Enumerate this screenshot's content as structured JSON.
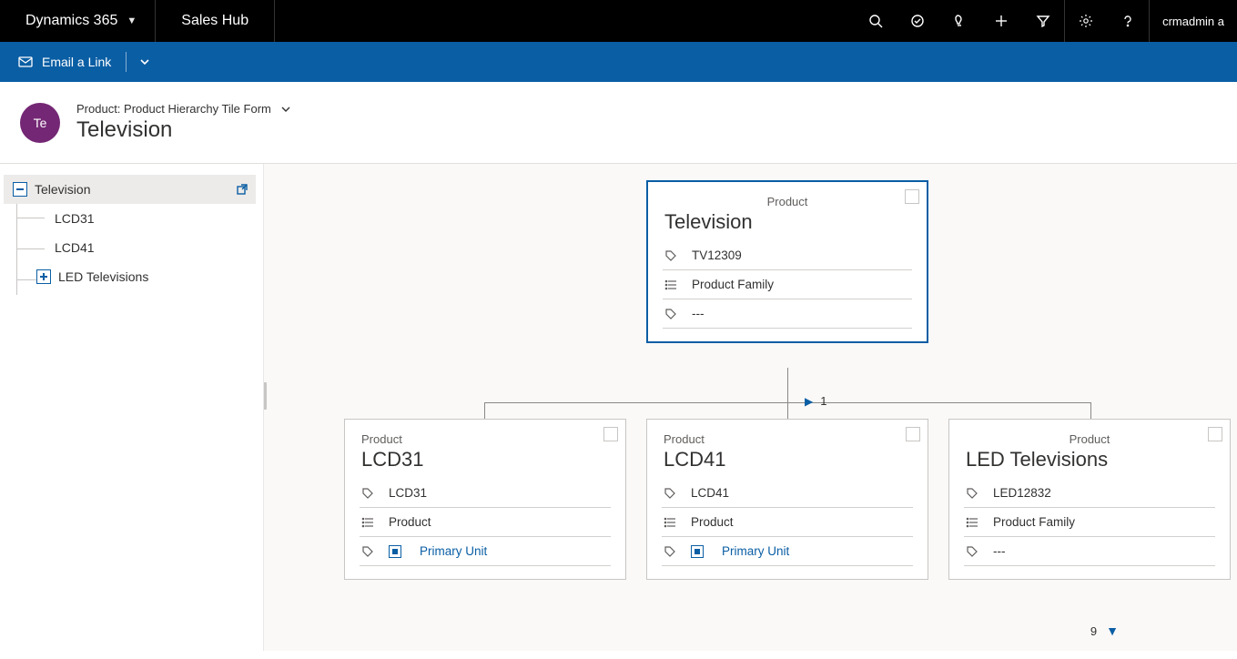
{
  "topbar": {
    "brand": "Dynamics 365",
    "app": "Sales Hub",
    "user": "crmadmin a"
  },
  "cmdbar": {
    "email_link": "Email a Link"
  },
  "header": {
    "avatar": "Te",
    "crumb": "Product: Product Hierarchy Tile Form",
    "title": "Television"
  },
  "tree": {
    "items": [
      {
        "label": "Television"
      },
      {
        "label": "LCD31"
      },
      {
        "label": "LCD41"
      },
      {
        "label": "LED Televisions"
      }
    ]
  },
  "paging": {
    "top": "1",
    "bottom": "9"
  },
  "tiles": {
    "root": {
      "kind": "Product",
      "name": "Television",
      "code": "TV12309",
      "type": "Product Family",
      "unit": "---"
    },
    "children": [
      {
        "kind": "Product",
        "name": "LCD31",
        "code": "LCD31",
        "type": "Product",
        "unit": "Primary Unit",
        "unit_link": true
      },
      {
        "kind": "Product",
        "name": "LCD41",
        "code": "LCD41",
        "type": "Product",
        "unit": "Primary Unit",
        "unit_link": true
      },
      {
        "kind": "Product",
        "name": "LED Televisions",
        "code": "LED12832",
        "type": "Product Family",
        "unit": "---",
        "unit_link": false
      }
    ]
  }
}
